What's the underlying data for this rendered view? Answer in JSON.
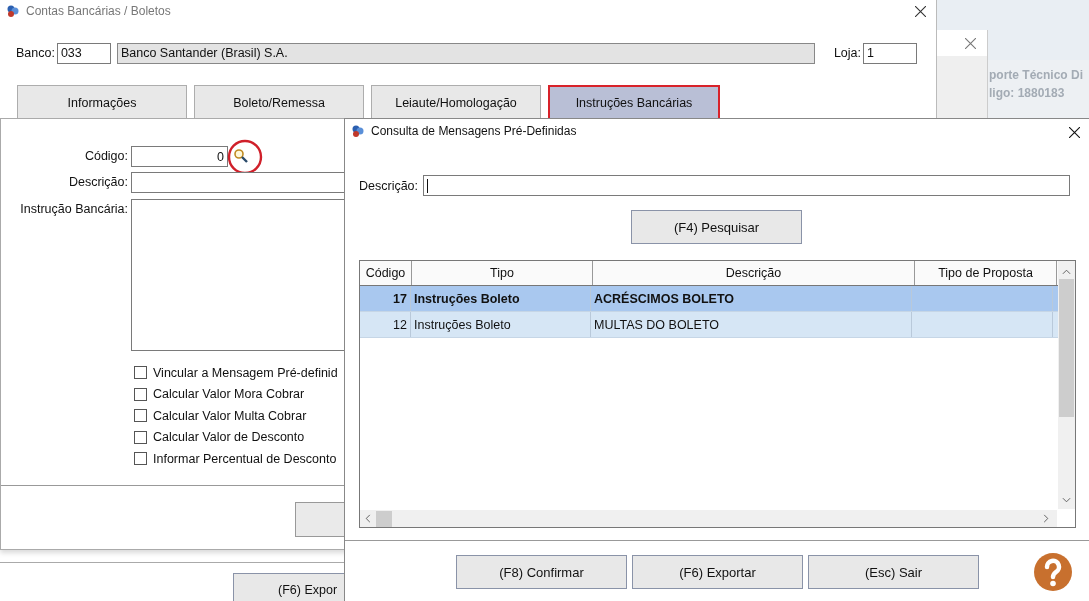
{
  "background_window": {
    "lines": [
      "porte Técnico Di",
      "ligo: 1880183"
    ]
  },
  "main_window": {
    "title": "Contas Bancárias / Boletos",
    "banco_label": "Banco:",
    "banco_code": "033",
    "banco_name": "Banco Santander (Brasil) S.A.",
    "loja_label": "Loja:",
    "loja": "1",
    "tabs": [
      {
        "label": "Informações",
        "selected": false
      },
      {
        "label": "Boleto/Remessa",
        "selected": false
      },
      {
        "label": "Leiaute/Homologação",
        "selected": false
      },
      {
        "label": "Instruções Bancárias",
        "selected": true
      }
    ],
    "form": {
      "codigo_label": "Código:",
      "codigo": "0",
      "descricao_label": "Descrição:",
      "instrucao_label": "Instrução Bancária:",
      "options": [
        {
          "label": "Vincular a Mensagem Pré-definid",
          "checked": false
        },
        {
          "label": "Calcular Valor Mora Cobrar",
          "checked": false
        },
        {
          "label": "Calcular Valor Multa Cobrar",
          "checked": false
        },
        {
          "label": "Calcular Valor de Desconto",
          "checked": false
        },
        {
          "label": "Informar Percentual de Desconto",
          "checked": false
        }
      ]
    },
    "footer_button": "(F6) Expor"
  },
  "dialog": {
    "title": "Consulta de Mensagens Pré-Definidas",
    "descricao_label": "Descrição:",
    "search_button": "(F4) Pesquisar",
    "table": {
      "columns": [
        "Código",
        "Tipo",
        "Descrição",
        "Tipo de Proposta"
      ],
      "rows": [
        {
          "codigo": "17",
          "tipo": "Instruções Boleto",
          "descricao": "ACRÉSCIMOS BOLETO",
          "selected": true
        },
        {
          "codigo": "12",
          "tipo": "Instruções Boleto",
          "descricao": "MULTAS DO BOLETO",
          "selected": false
        }
      ]
    },
    "buttons": [
      "(F8) Confirmar",
      "(F6) Exportar",
      "(Esc) Sair"
    ]
  }
}
